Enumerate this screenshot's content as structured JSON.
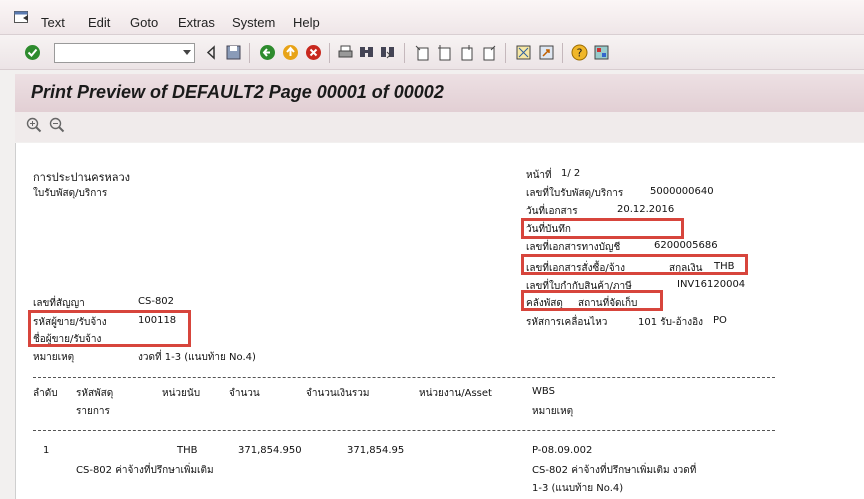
{
  "menu": [
    "Text",
    "Edit",
    "Goto",
    "Extras",
    "System",
    "Help"
  ],
  "toolbar": {
    "command_field_value": ""
  },
  "title": "Print Preview of DEFAULT2 Page 00001 of 00002",
  "doc": {
    "company": "การประปานครหลวง",
    "doc_title": "ใบรับพัสดุ/บริการ",
    "page_label": "หน้าที่",
    "page_value": "1/ 2",
    "gr_label": "เลขที่ใบรับพัสดุ/บริการ",
    "gr_value": "5000000640",
    "doc_date_label": "วันที่เอกสาร",
    "doc_date_value": "20.12.2016",
    "post_date_label": "วันที่บันทึก",
    "acc_doc_label": "เลขที่เอกสารทางบัญชี",
    "acc_doc_value": "6200005686",
    "po_label": "เลขที่เอกสารสั่งซื้อ/จ้าง",
    "currency_label": "สกุลเงิน",
    "currency_value": "THB",
    "invoice_label": "เลขที่ใบกำกับสินค้า/ภาษี",
    "invoice_value": "INV16120004",
    "plant_label": "คลังพัสดุ",
    "sloc_label": "สถานที่จัดเก็บ",
    "contract_label": "เลขที่สัญญา",
    "contract_value": "CS-802",
    "vendor_code_label": "รหัสผู้ขาย/รับจ้าง",
    "vendor_code_value": "100118",
    "vendor_name_label": "ชื่อผู้ขาย/รับจ้าง",
    "mvt_label": "รหัสการเคลื่อนไหว",
    "mvt_value": "101 รับ-อ้างอิง",
    "mvt_po": "PO",
    "remark_label": "หมายเหตุ",
    "remark_value": "งวดที่  1-3  (แนบท้าย  No.4)"
  },
  "table": {
    "headers": {
      "seq": "ลำดับ",
      "material": "รหัสพัสดุ",
      "item_desc": "รายการ",
      "unit": "หน่วยนับ",
      "qty": "จำนวน",
      "amount": "จำนวนเงินรวม",
      "dept": "หน่วยงาน/Asset",
      "wbs": "WBS",
      "wbs_remark": "หมายเหตุ"
    },
    "row1": {
      "seq": "1",
      "unit": "THB",
      "qty": "371,854.950",
      "amount": "371,854.95",
      "wbs": "P-08.09.002",
      "desc": "CS-802 ค่าจ้างที่ปรึกษาเพิ่มเติม",
      "wbs_desc": "CS-802 ค่าจ้างที่ปรึกษาเพิ่มเติม งวดที่",
      "wbs_desc2": "1-3    (แนบท้าย  No.4)"
    }
  },
  "colors": {
    "highlight": "#d7453c",
    "title_bg": "#e6d4d8"
  }
}
